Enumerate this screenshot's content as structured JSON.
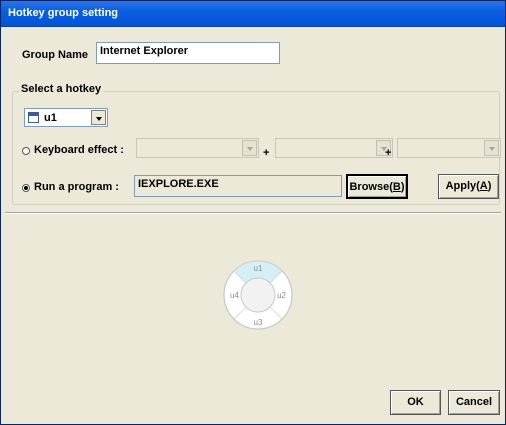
{
  "window": {
    "title": "Hotkey group setting"
  },
  "group_name": {
    "label": "Group Name",
    "value": "Internet Explorer"
  },
  "hotkey_section": {
    "label": "Select a hotkey",
    "selected_hotkey": "u1",
    "plus_sign": "+",
    "keyboard_effect": {
      "label": "Keyboard effect :",
      "checked": false
    },
    "run_program": {
      "label": "Run a program :",
      "checked": true,
      "value": "IEXPLORE.EXE"
    },
    "browse_button": {
      "label": "Browse",
      "mnemonic": "B"
    },
    "apply_button": {
      "label": "Apply",
      "mnemonic": "A"
    }
  },
  "hotkey_wheel": {
    "top": "u1",
    "right": "u2",
    "bottom": "u3",
    "left": "u4",
    "highlight_color": "#d4f0f4"
  },
  "footer": {
    "ok_label": "OK",
    "cancel_label": "Cancel"
  }
}
